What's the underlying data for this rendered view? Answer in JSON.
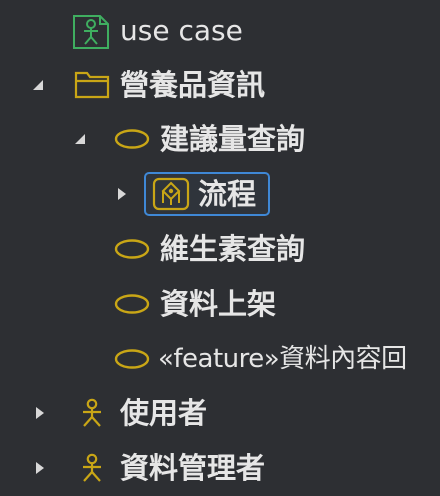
{
  "tree": {
    "items": [
      {
        "label": "use case",
        "icon": "actor-document-icon",
        "level": 1,
        "expander": "none"
      },
      {
        "label": "營養品資訊",
        "icon": "folder-icon",
        "level": 1,
        "expander": "expanded"
      },
      {
        "label": "建議量查詢",
        "icon": "use-case-ellipse-icon",
        "level": 2,
        "expander": "expanded"
      },
      {
        "label": "流程",
        "icon": "activity-diagram-icon",
        "level": 3,
        "expander": "collapsed",
        "selected": true
      },
      {
        "label": "維生素查詢",
        "icon": "use-case-ellipse-icon",
        "level": 2,
        "expander": "none"
      },
      {
        "label": "資料上架",
        "icon": "use-case-ellipse-icon",
        "level": 2,
        "expander": "none"
      },
      {
        "label": "«feature»資料內容回",
        "icon": "use-case-ellipse-icon",
        "level": 2,
        "expander": "none"
      },
      {
        "label": "使用者",
        "icon": "actor-icon",
        "level": 1,
        "expander": "collapsed"
      },
      {
        "label": "資料管理者",
        "icon": "actor-icon",
        "level": 1,
        "expander": "collapsed"
      }
    ]
  },
  "colors": {
    "background": "#2d2f33",
    "text": "#e6e6e6",
    "icon_gold": "#c9a616",
    "icon_green": "#3fae60",
    "selection_border": "#3f88d6",
    "expander": "#d8d8d8"
  }
}
